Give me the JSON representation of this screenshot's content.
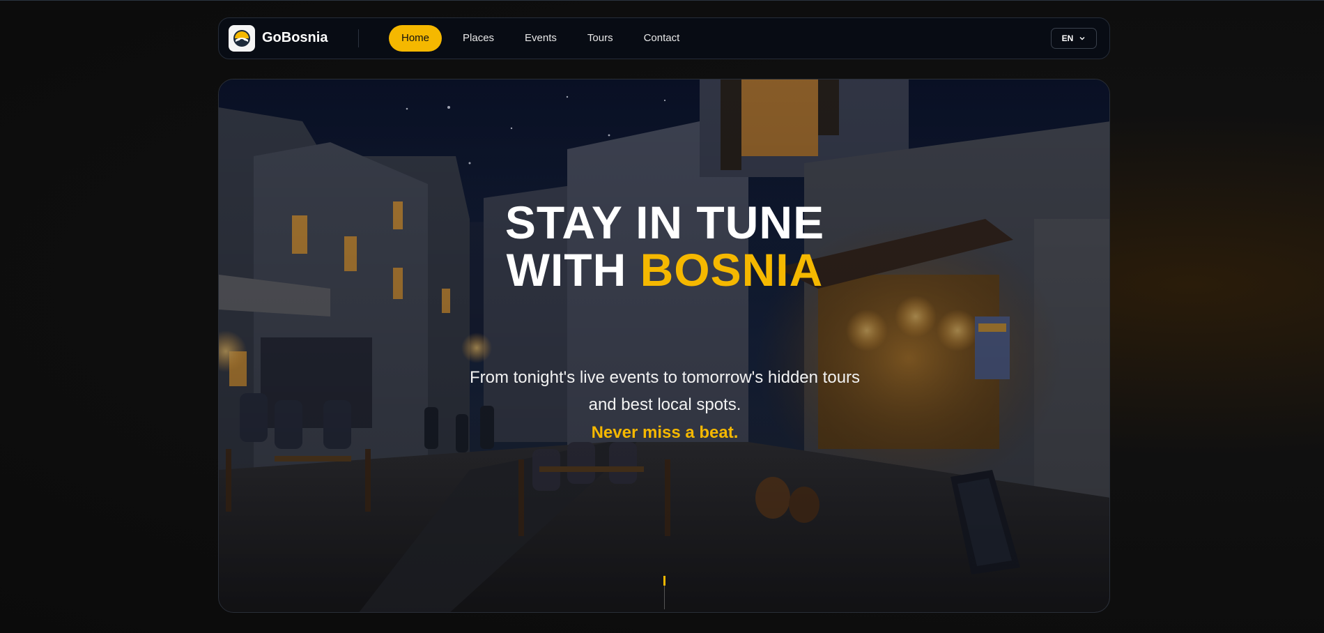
{
  "brand": {
    "name": "GoBosnia",
    "logo_icon": "gobosnia-logo-icon"
  },
  "nav": {
    "items": [
      {
        "label": "Home",
        "active": true
      },
      {
        "label": "Places",
        "active": false
      },
      {
        "label": "Events",
        "active": false
      },
      {
        "label": "Tours",
        "active": false
      },
      {
        "label": "Contact",
        "active": false
      }
    ],
    "language": {
      "value": "EN",
      "icon": "chevron-down-icon"
    }
  },
  "hero": {
    "title_line1": "STAY IN TUNE",
    "title_line2_prefix": "WITH ",
    "title_line2_accent": "BOSNIA",
    "subtitle_line1": "From tonight's live events to tomorrow's hidden tours",
    "subtitle_line2": "and best local spots.",
    "tagline": "Never miss a beat.",
    "background": "illustrated night street with cafes and lanterns"
  },
  "colors": {
    "accent": "#f5b800",
    "nav_bg": "#080c14",
    "page_bg": "#0f0f0f"
  }
}
